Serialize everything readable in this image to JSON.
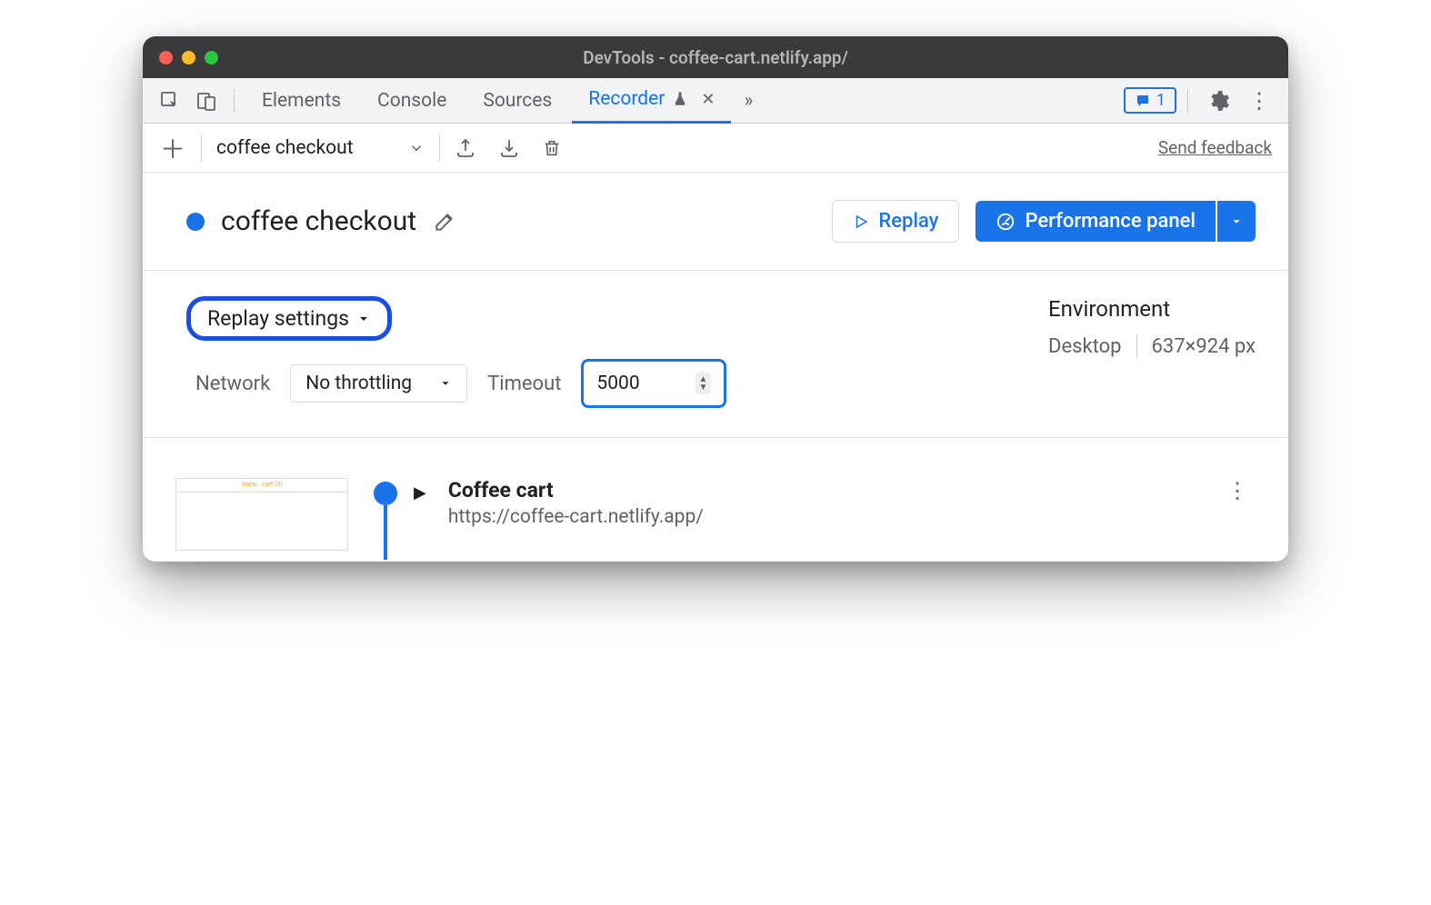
{
  "window": {
    "title": "DevTools - coffee-cart.netlify.app/"
  },
  "tabs": {
    "items": [
      "Elements",
      "Console",
      "Sources"
    ],
    "active": "Recorder",
    "more_glyph": "»",
    "issues_count": "1"
  },
  "toolbar": {
    "recording_select": "coffee checkout",
    "send_feedback": "Send feedback"
  },
  "header": {
    "title": "coffee checkout",
    "replay_label": "Replay",
    "perf_label": "Performance panel"
  },
  "settings": {
    "replay_settings_label": "Replay settings",
    "network_label": "Network",
    "network_value": "No throttling",
    "timeout_label": "Timeout",
    "timeout_value": "5000",
    "env_title": "Environment",
    "env_device": "Desktop",
    "env_dims": "637×924 px"
  },
  "step": {
    "title": "Coffee cart",
    "url": "https://coffee-cart.netlify.app/"
  }
}
